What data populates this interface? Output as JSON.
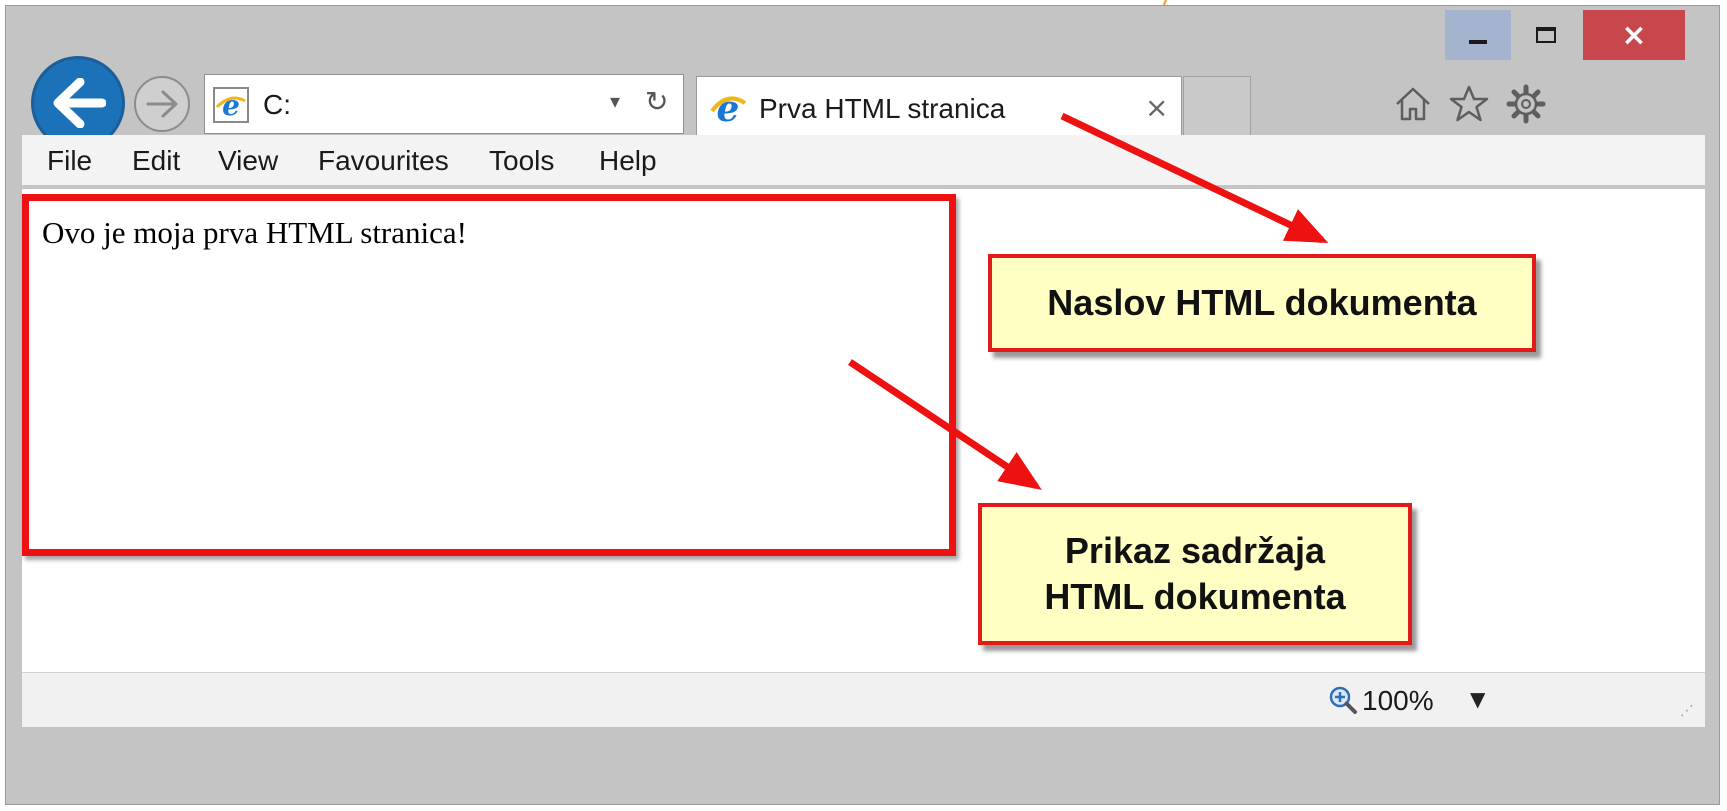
{
  "browser": {
    "address": {
      "text": "C:"
    },
    "tab": {
      "title": "Prva HTML stranica",
      "close": "×"
    },
    "menu": [
      "File",
      "Edit",
      "View",
      "Favourites",
      "Tools",
      "Help"
    ],
    "caption": {
      "close": "×"
    }
  },
  "page": {
    "text": "Ovo je moja prva HTML stranica!"
  },
  "status": {
    "zoom": "100%"
  },
  "annotations": {
    "callout_title": "Naslov HTML dokumenta",
    "callout_content_line1": "Prikaz sadržaja",
    "callout_content_line2": "HTML dokumenta"
  },
  "colors": {
    "annotation_red": "#ee1111",
    "callout_fill": "#ffffc4",
    "back_button_blue": "#1c72b9",
    "close_button_red": "#c8474c"
  },
  "icons": [
    "back-arrow-icon",
    "forward-arrow-icon",
    "ie-logo-icon",
    "refresh-icon",
    "home-icon",
    "star-icon",
    "gear-icon",
    "zoom-icon"
  ]
}
